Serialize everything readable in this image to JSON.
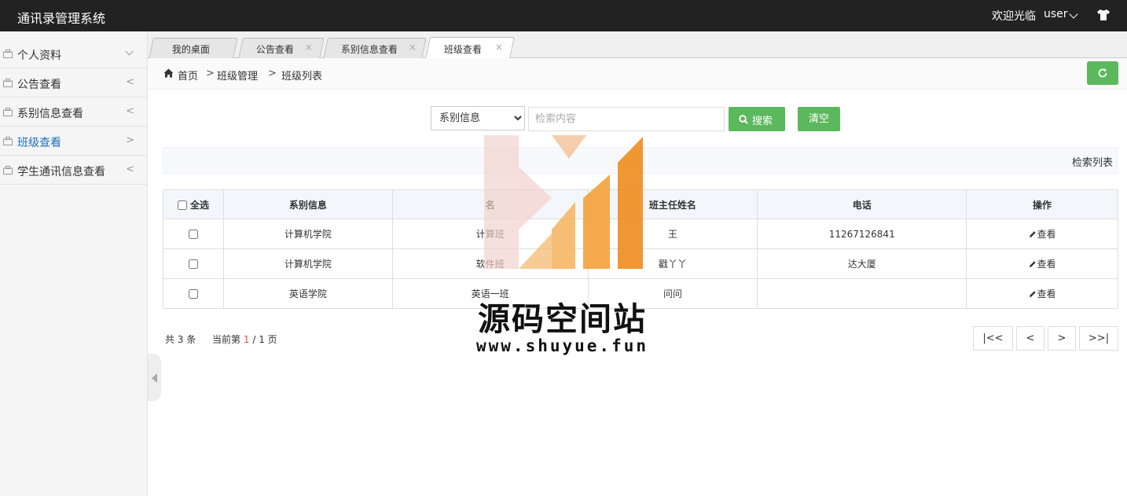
{
  "header": {
    "app_title": "通讯录管理系统",
    "welcome": "欢迎光临",
    "username": "user",
    "user_menu_icon": "chevron-down-icon",
    "theme_icon": "shirt-icon"
  },
  "sidebar": {
    "items": [
      {
        "label": "个人资料",
        "arrow": "expanded"
      },
      {
        "label": "公告查看",
        "arrow": "<"
      },
      {
        "label": "系别信息查看",
        "arrow": "<"
      },
      {
        "label": "班级查看",
        "arrow": ">",
        "active": true
      },
      {
        "label": "学生通讯信息查看",
        "arrow": "<"
      }
    ],
    "active_color": "#1e6fbf"
  },
  "tabs": [
    {
      "label": "我的桌面",
      "closable": false
    },
    {
      "label": "公告查看",
      "closable": true,
      "close": "×"
    },
    {
      "label": "系别信息查看",
      "closable": true,
      "close": "×"
    },
    {
      "label": "班级查看",
      "closable": true,
      "close": "×",
      "active": true
    }
  ],
  "breadcrumb": {
    "home": "首页",
    "separator": ">",
    "level2": "班级管理",
    "level3": "班级列表"
  },
  "search": {
    "select_value": "系别信息",
    "select_options": [
      "系别信息"
    ],
    "placeholder": "检索内容",
    "value": "",
    "search_label": "搜索",
    "clear_label": "清空"
  },
  "list_title": "检索列表",
  "table": {
    "select_all_label": "全选",
    "columns": [
      "系别信息",
      "名",
      "班主任姓名",
      "电话",
      "操作"
    ],
    "rows": [
      {
        "dept": "计算机学院",
        "name": "计算",
        "name_tail": "班",
        "teacher": "王",
        "phone": "11267126841",
        "action": "查看"
      },
      {
        "dept": "计算机学院",
        "name": "软件",
        "name_tail": "班",
        "teacher": "戳丫丫",
        "phone": "达大厦",
        "action": "查看"
      },
      {
        "dept": "英语学院",
        "name": "英语一班",
        "name_tail": "",
        "teacher": "问问",
        "phone": "",
        "action": "查看"
      }
    ]
  },
  "pagination": {
    "total_prefix": "共",
    "total": "3",
    "total_suffix": "条",
    "current_prefix": "当前第",
    "current": "1",
    "sep": "/",
    "pages": "1",
    "pages_suffix": "页",
    "first": "|<<",
    "prev": "<",
    "next": ">",
    "last": ">>|"
  },
  "watermark": {
    "title": "源码空间站",
    "url": "www.shuyue.fun",
    "colors": [
      "#f08c1e",
      "#f4b66a",
      "#f2d1cc"
    ]
  },
  "colors": {
    "header_bg": "#222222",
    "primary_green": "#5cb85c",
    "page_number_red": "#d9534f"
  }
}
